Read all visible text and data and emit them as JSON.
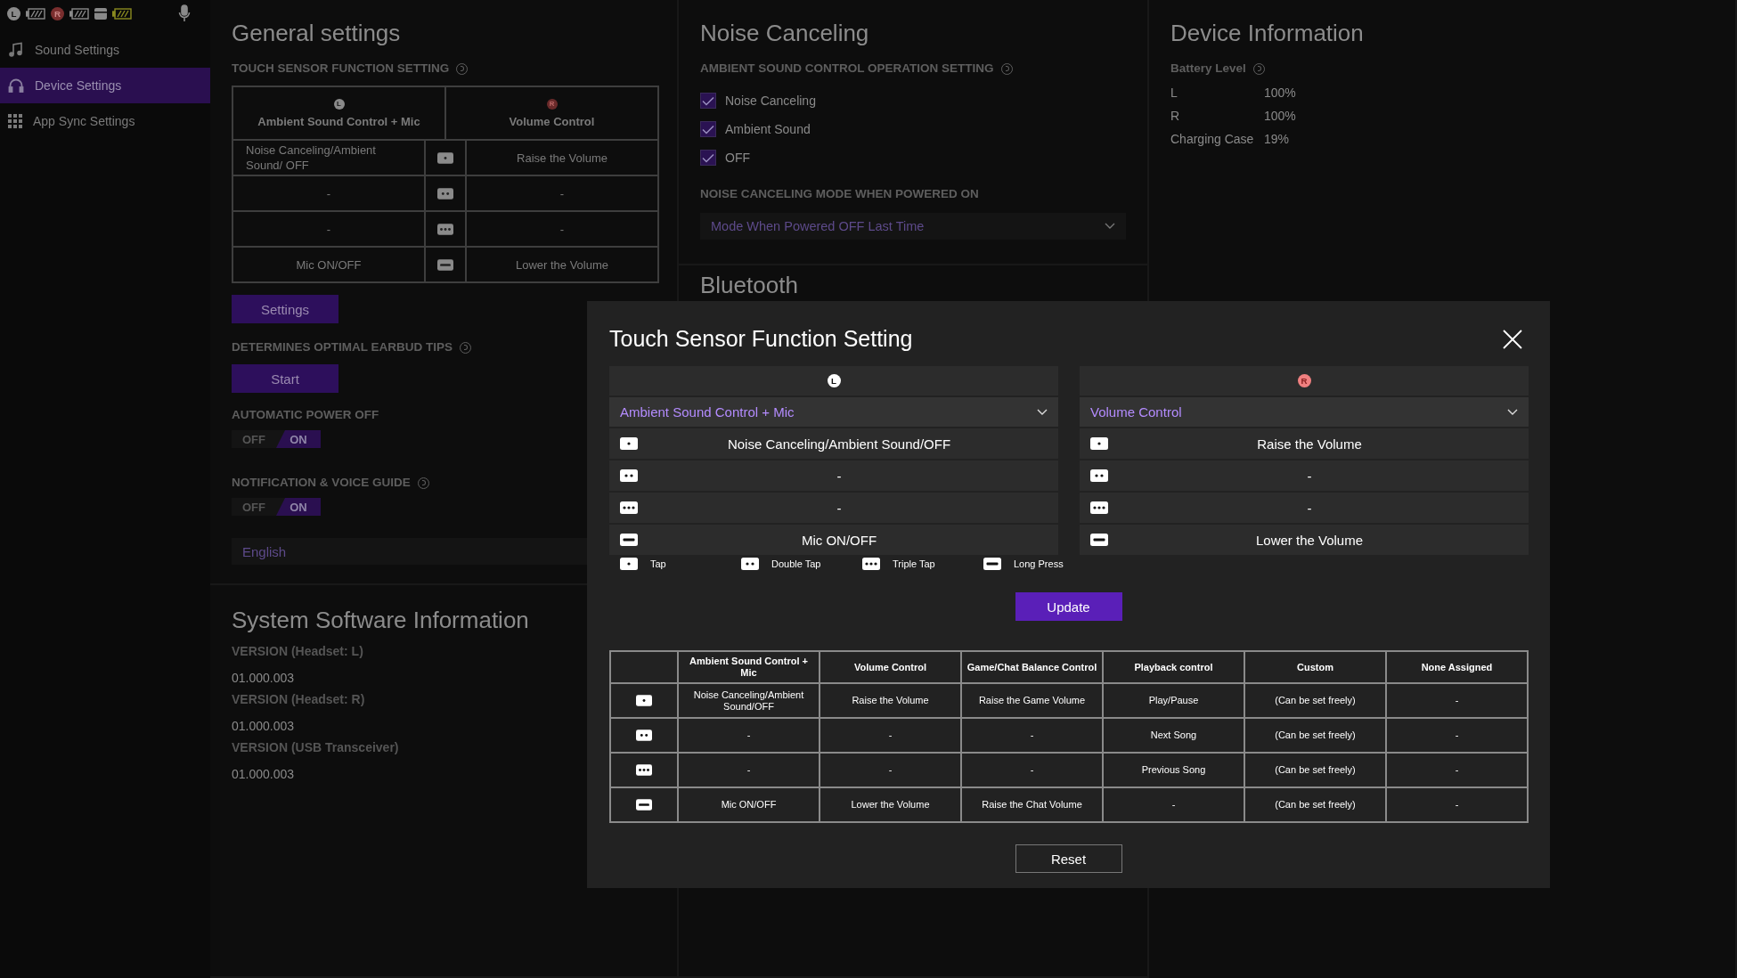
{
  "status_bar": {
    "left_badge": "L",
    "right_badge": "R"
  },
  "sidebar": {
    "items": [
      {
        "label": "Sound Settings",
        "kind": "music",
        "selected": false
      },
      {
        "label": "Device Settings",
        "kind": "headphones",
        "selected": true
      },
      {
        "label": "App Sync Settings",
        "kind": "apps",
        "selected": false
      }
    ]
  },
  "general": {
    "title": "General settings",
    "touch_sensor": {
      "label": "TOUCH SENSOR FUNCTION SETTING",
      "left": {
        "badge": "L",
        "name": "Ambient Sound Control + Mic"
      },
      "right": {
        "badge": "R",
        "name": "Volume Control"
      },
      "rows": [
        {
          "kind": "tap",
          "left": "Noise Canceling/Ambient Sound/ OFF",
          "right": "Raise the Volume"
        },
        {
          "kind": "double",
          "left": "-",
          "right": "-"
        },
        {
          "kind": "triple",
          "left": "-",
          "right": "-"
        },
        {
          "kind": "long",
          "left": "Mic ON/OFF",
          "right": "Lower the Volume"
        }
      ]
    },
    "settings_button": "Settings",
    "earbud_tips": {
      "label": "DETERMINES OPTIMAL EARBUD TIPS",
      "button": "Start"
    },
    "auto_power_off": {
      "label": "AUTOMATIC POWER OFF",
      "off_label": "OFF",
      "on_label": "ON",
      "enabled": true
    },
    "notification": {
      "label": "NOTIFICATION & VOICE GUIDE",
      "off_label": "OFF",
      "on_label": "ON",
      "enabled": true
    },
    "language": "English"
  },
  "system_software": {
    "title": "System Software Information",
    "items": [
      {
        "label": "VERSION (Headset: L)",
        "value": "01.000.003"
      },
      {
        "label": "VERSION (Headset: R)",
        "value": "01.000.003"
      },
      {
        "label": "VERSION (USB Transceiver)",
        "value": "01.000.003"
      }
    ]
  },
  "noise_canceling": {
    "title": "Noise Canceling",
    "label": "AMBIENT SOUND CONTROL OPERATION SETTING",
    "options": [
      {
        "label": "Noise Canceling",
        "checked": true
      },
      {
        "label": "Ambient Sound",
        "checked": true
      },
      {
        "label": "OFF",
        "checked": true
      }
    ],
    "mode_label": "NOISE CANCELING MODE WHEN POWERED ON",
    "mode_value": "Mode When Powered OFF Last Time"
  },
  "bluetooth": {
    "title": "Bluetooth"
  },
  "device_info": {
    "title": "Device Information",
    "battery_label": "Battery Level",
    "rows": [
      {
        "name": "L",
        "value": "100%"
      },
      {
        "name": "R",
        "value": "100%"
      },
      {
        "name": "Charging Case",
        "value": "19%"
      }
    ]
  },
  "modal": {
    "title": "Touch Sensor Function Setting",
    "panels": [
      {
        "badge": "L",
        "selection": "Ambient Sound Control + Mic",
        "rows": [
          {
            "kind": "tap",
            "text": "Noise Canceling/Ambient Sound/OFF"
          },
          {
            "kind": "double",
            "text": "-"
          },
          {
            "kind": "triple",
            "text": "-"
          },
          {
            "kind": "long",
            "text": "Mic ON/OFF"
          }
        ]
      },
      {
        "badge": "R",
        "selection": "Volume Control",
        "rows": [
          {
            "kind": "tap",
            "text": "Raise the Volume"
          },
          {
            "kind": "double",
            "text": "-"
          },
          {
            "kind": "triple",
            "text": "-"
          },
          {
            "kind": "long",
            "text": "Lower the Volume"
          }
        ]
      }
    ],
    "legend": [
      {
        "kind": "tap",
        "label": "Tap"
      },
      {
        "kind": "double",
        "label": "Double Tap"
      },
      {
        "kind": "triple",
        "label": "Triple Tap"
      },
      {
        "kind": "long",
        "label": "Long Press"
      }
    ],
    "update_button": "Update",
    "reference_table": {
      "columns": [
        "Ambient Sound Control + Mic",
        "Volume Control",
        "Game/Chat Balance Control",
        "Playback control",
        "Custom",
        "None Assigned"
      ],
      "rows": [
        {
          "kind": "tap",
          "cells": [
            "Noise Canceling/Ambient Sound/OFF",
            "Raise the Volume",
            "Raise the Game Volume",
            "Play/Pause",
            "(Can be set freely)",
            "-"
          ]
        },
        {
          "kind": "double",
          "cells": [
            "-",
            "-",
            "-",
            "Next Song",
            "(Can be set freely)",
            "-"
          ]
        },
        {
          "kind": "triple",
          "cells": [
            "-",
            "-",
            "-",
            "Previous Song",
            "(Can be set freely)",
            "-"
          ]
        },
        {
          "kind": "long",
          "cells": [
            "Mic ON/OFF",
            "Lower the Volume",
            "Raise the Chat Volume",
            "-",
            "(Can be set freely)",
            "-"
          ]
        }
      ]
    },
    "reset_button": "Reset"
  }
}
